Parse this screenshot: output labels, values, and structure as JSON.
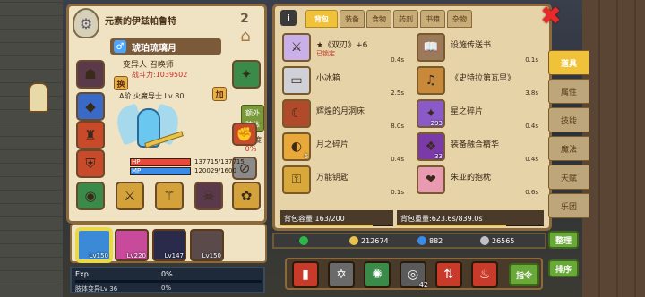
{
  "character": {
    "title": "元素的伊兹帕鲁特",
    "name": "琥珀琉璃月",
    "gender_icon": "male-symbol",
    "class_line": "变异人  召唤师",
    "power_label": "战斗力:1039502",
    "level_line": "A阶 火魔导士 Lv 80",
    "corner_number": "2",
    "swap_label": "换",
    "plus_label": "加",
    "extra_tag": "额外\n肢体",
    "hunger_label": "饱腹度",
    "hunger_value": "0%",
    "hp_label": "HP",
    "mp_label": "MP",
    "hp_value": "137715/137715",
    "mp_value": "120029/1600",
    "hp_fraction": 1.0,
    "mp_fraction": 1.0
  },
  "party": [
    {
      "lv": "Lv150",
      "color": "#3a8ad8",
      "selected": true
    },
    {
      "lv": "Lv220",
      "color": "#c84a9a",
      "selected": false
    },
    {
      "lv": "Lv147",
      "color": "#2a2a4a",
      "selected": false
    },
    {
      "lv": "Lv150",
      "color": "#5a4a4a",
      "selected": false
    }
  ],
  "exp": {
    "label": "Exp",
    "pct": "0%",
    "sub_label": "肢体变异Lv 36",
    "sub_pct": "0%",
    "fraction": 0.0
  },
  "bag": {
    "info_label": "i",
    "tabs": [
      "背包",
      "装备",
      "食物",
      "药剂",
      "书籍",
      "杂物"
    ],
    "active_tab": 0,
    "close_label": "✖",
    "items": [
      {
        "name": "★《双刃》+6",
        "lock": "已锁定",
        "weight": "0.4s",
        "count": "",
        "icon": "dual-blade-icon",
        "color": "#c9b0e8"
      },
      {
        "name": "设施传送书",
        "lock": "",
        "weight": "0.1s",
        "count": "",
        "icon": "teleport-book-icon",
        "color": "#9a7a5a"
      },
      {
        "name": "小冰箱",
        "lock": "",
        "weight": "2.5s",
        "count": "",
        "icon": "fridge-icon",
        "color": "#d0d0d8"
      },
      {
        "name": "《史特拉第瓦里》",
        "lock": "",
        "weight": "3.8s",
        "count": "",
        "icon": "violin-icon",
        "color": "#c88a3a"
      },
      {
        "name": "辉煌的月洞床",
        "lock": "",
        "weight": "8.0s",
        "count": "",
        "icon": "moon-bed-icon",
        "color": "#b04a2a"
      },
      {
        "name": "星之碎片",
        "lock": "",
        "weight": "0.4s",
        "count": "293",
        "icon": "star-shard-icon",
        "color": "#8a5ac8"
      },
      {
        "name": "月之碎片",
        "lock": "",
        "weight": "0.4s",
        "count": "6",
        "icon": "moon-shard-icon",
        "color": "#e8a83a"
      },
      {
        "name": "装备融合精华",
        "lock": "",
        "weight": "0.4s",
        "count": "33",
        "icon": "fusion-essence-icon",
        "color": "#7a3aa8"
      },
      {
        "name": "万能钥匙",
        "lock": "",
        "weight": "0.1s",
        "count": "",
        "icon": "master-key-icon",
        "color": "#d8a83a"
      },
      {
        "name": "朱亚的抱枕",
        "lock": "",
        "weight": "0.6s",
        "count": "",
        "icon": "pillow-icon",
        "color": "#e89ab0"
      }
    ],
    "capacity_label": "背包容量 163/200",
    "capacity_fraction": 0.815,
    "weight_label": "背包重量:623.6s/839.0s",
    "weight_fraction": 0.743
  },
  "side_tabs": [
    "道具",
    "属性",
    "技能",
    "魔法",
    "天赋",
    "乐团"
  ],
  "side_active": 0,
  "currency": {
    "gold": "212674",
    "gem": "882",
    "silver": "26565"
  },
  "buttons": {
    "sort": "整理",
    "arrange": "排序",
    "command": "指令"
  },
  "skills": [
    {
      "icon": "red-card-icon",
      "color": "#c83a2a",
      "sub": ""
    },
    {
      "icon": "hexagram-icon",
      "color": "#6a6a6a",
      "sub": ""
    },
    {
      "icon": "green-burst-icon",
      "color": "#3a8a4a",
      "sub": ""
    },
    {
      "icon": "eye-icon",
      "color": "#5a5a5a",
      "sub": "42"
    },
    {
      "icon": "red-arrows-icon",
      "color": "#c83a2a",
      "sub": ""
    },
    {
      "icon": "fire-icon",
      "color": "#c83a2a",
      "sub": ""
    }
  ]
}
